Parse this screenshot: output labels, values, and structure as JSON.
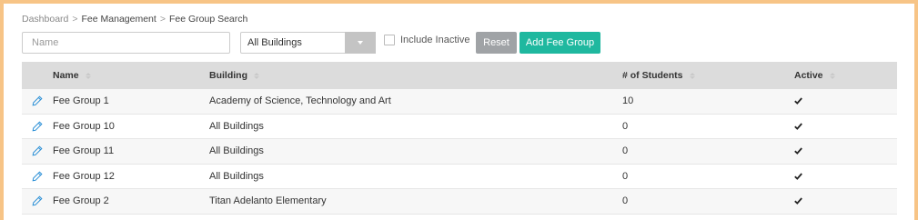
{
  "breadcrumb": {
    "root": "Dashboard",
    "sep": ">",
    "middle": "Fee Management",
    "current": "Fee Group Search"
  },
  "filters": {
    "name_placeholder": "Name",
    "name_value": "",
    "building_selected": "All Buildings",
    "include_inactive_label": "Include Inactive",
    "include_inactive_checked": false
  },
  "buttons": {
    "reset_label": "Reset",
    "add_label": "Add Fee Group"
  },
  "table": {
    "columns": [
      "Name",
      "Building",
      "# of Students",
      "Active"
    ],
    "rows": [
      {
        "name": "Fee Group 1",
        "building": "Academy of Science, Technology and Art",
        "students": "10",
        "active": true
      },
      {
        "name": "Fee Group 10",
        "building": "All Buildings",
        "students": "0",
        "active": true
      },
      {
        "name": "Fee Group 11",
        "building": "All Buildings",
        "students": "0",
        "active": true
      },
      {
        "name": "Fee Group 12",
        "building": "All Buildings",
        "students": "0",
        "active": true
      },
      {
        "name": "Fee Group 2",
        "building": "Titan Adelanto Elementary",
        "students": "0",
        "active": true
      }
    ]
  },
  "colors": {
    "accent": "#1fb89f",
    "reset": "#a0a3a6",
    "border_frame": "#f7c486",
    "edit_icon": "#2a8fd6"
  },
  "icons": {
    "edit": "pencil-icon",
    "active": "check-icon",
    "sort": "sort-icon",
    "dropdown": "chevron-down-icon"
  }
}
